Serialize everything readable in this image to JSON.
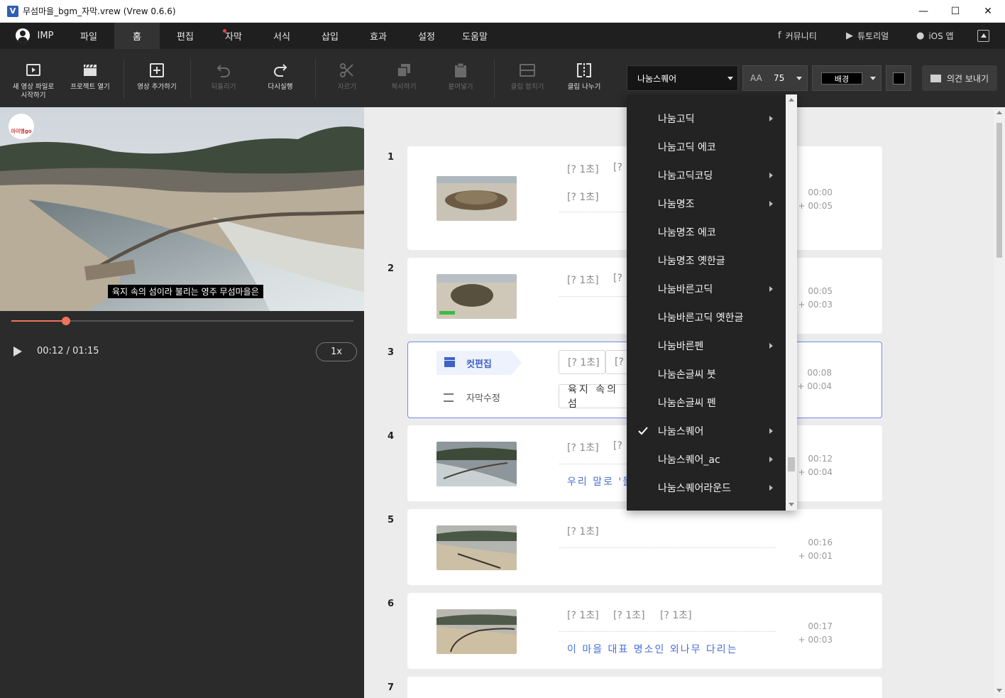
{
  "window": {
    "title": "무섬마을_bgm_자막.vrew (Vrew 0.6.6)",
    "app_icon": "V",
    "controls": {
      "minimize": "—",
      "maximize": "☐",
      "close": "✕"
    }
  },
  "menubar": {
    "user": "IMP",
    "items": [
      "파일",
      "홈",
      "편집",
      "자막",
      "서식",
      "삽입",
      "효과",
      "설정",
      "도움말"
    ],
    "active": "홈",
    "links": {
      "community": "커뮤니티",
      "tutorial": "튜토리얼",
      "ios": "iOS 앱"
    }
  },
  "toolbar": {
    "new_video": "새 영상 파일로\n시작하기",
    "open_project": "프로젝트 열기",
    "add_video": "영상 추가하기",
    "undo": "되돌리기",
    "redo": "다시실행",
    "cut": "자르기",
    "copy": "복사하기",
    "paste": "붙여넣기",
    "merge_clip": "클립 합치기",
    "split_clip": "클립 나누기",
    "font_name": "나눔스퀘어",
    "font_size_icon": "AA",
    "font_size": "75",
    "background_label": "배경",
    "feedback": "의견 보내기"
  },
  "font_dropdown": {
    "items": [
      {
        "label": "나눔고딕",
        "submenu": true,
        "checked": false
      },
      {
        "label": "나눔고딕 에코",
        "submenu": false,
        "checked": false
      },
      {
        "label": "나눔고딕코딩",
        "submenu": true,
        "checked": false
      },
      {
        "label": "나눔명조",
        "submenu": true,
        "checked": false
      },
      {
        "label": "나눔명조 에코",
        "submenu": false,
        "checked": false
      },
      {
        "label": "나눔명조 옛한글",
        "submenu": false,
        "checked": false
      },
      {
        "label": "나눔바른고딕",
        "submenu": true,
        "checked": false
      },
      {
        "label": "나눔바른고딕 옛한글",
        "submenu": false,
        "checked": false
      },
      {
        "label": "나눔바른펜",
        "submenu": true,
        "checked": false
      },
      {
        "label": "나눔손글씨 붓",
        "submenu": false,
        "checked": false
      },
      {
        "label": "나눔손글씨 펜",
        "submenu": false,
        "checked": false
      },
      {
        "label": "나눔스퀘어",
        "submenu": true,
        "checked": true
      },
      {
        "label": "나눔스퀘어_ac",
        "submenu": true,
        "checked": false
      },
      {
        "label": "나눔스퀘어라운드",
        "submenu": true,
        "checked": false
      }
    ]
  },
  "preview": {
    "logo": "아이엠go",
    "subtitle": "육지 속의 섬이라 불리는 영주 무섬마을은",
    "progress": 0.16,
    "time": "00:12 / 01:15",
    "speed": "1x"
  },
  "clips": [
    {
      "num": "1",
      "silences": [
        "[? 1초]",
        "[?"
      ],
      "silences2": [
        "[? 1초]"
      ],
      "caption": "",
      "start": "00:00",
      "dur": "+ 00:05"
    },
    {
      "num": "2",
      "silences": [
        "[? 1초]",
        "[?"
      ],
      "caption": "",
      "start": "00:05",
      "dur": "+ 00:03"
    },
    {
      "num": "3",
      "silences": [
        "[? 1초]",
        "[?"
      ],
      "caption": "육지 속의 섬",
      "start": "00:08",
      "dur": "+ 00:04",
      "cut_edit": "컷편집",
      "sub_edit": "자막수정"
    },
    {
      "num": "4",
      "silences": [
        "[? 1초]",
        "[?"
      ],
      "caption": "우리 말로 '둘",
      "start": "00:12",
      "dur": "+ 00:04"
    },
    {
      "num": "5",
      "silences": [
        "[? 1초]"
      ],
      "caption": "",
      "start": "00:16",
      "dur": "+ 00:01"
    },
    {
      "num": "6",
      "silences": [
        "[? 1초]",
        "[? 1초]",
        "[? 1초]"
      ],
      "caption": "이 마을 대표 명소인 외나무 다리는",
      "start": "00:17",
      "dur": "+ 00:03"
    },
    {
      "num": "7",
      "silences": [],
      "caption": "",
      "start": "",
      "dur": ""
    }
  ]
}
